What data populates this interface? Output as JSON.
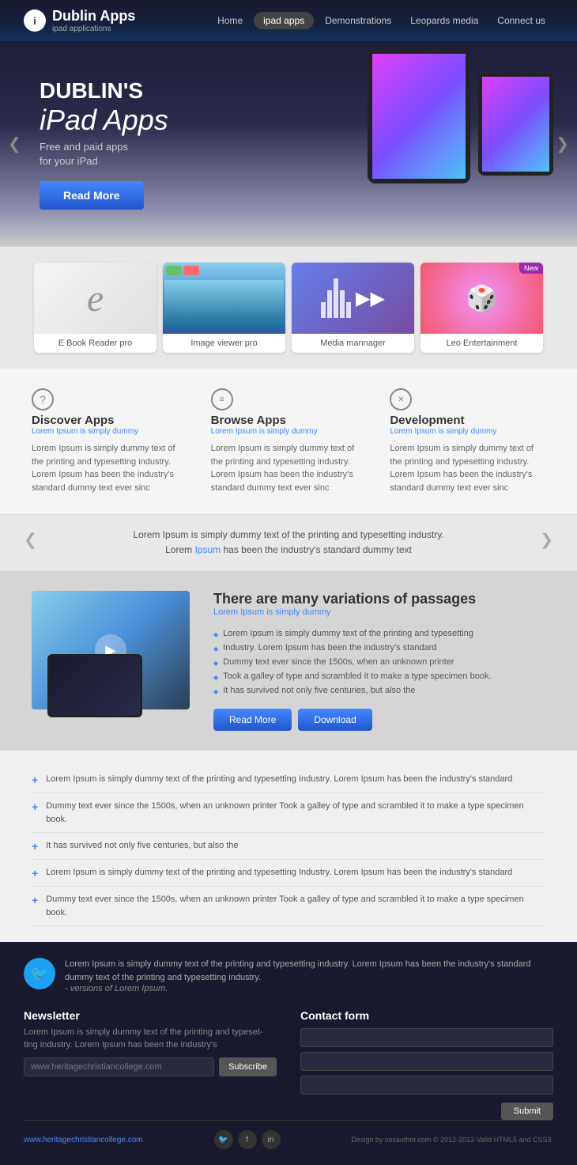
{
  "header": {
    "logo_icon": "i",
    "logo_title": "Dublin Apps",
    "logo_sub": "ipad applications",
    "nav": [
      {
        "label": "Home",
        "active": false
      },
      {
        "label": "ipad apps",
        "active": true
      },
      {
        "label": "Demonstrations",
        "active": false
      },
      {
        "label": "Leopards media",
        "active": false
      },
      {
        "label": "Connect us",
        "active": false
      }
    ]
  },
  "hero": {
    "title_main": "DUBLIN'S",
    "title_sub": "iPad Apps",
    "desc_line1": "Free and paid apps",
    "desc_line2": "for your iPad",
    "btn_read_more": "Read More",
    "arrow_left": "❮",
    "arrow_right": "❯"
  },
  "apps": {
    "items": [
      {
        "label": "E Book Reader pro",
        "type": "ebook",
        "new": false
      },
      {
        "label": "Image viewer pro",
        "type": "viewer",
        "new": false
      },
      {
        "label": "Media mannager",
        "type": "media",
        "new": false
      },
      {
        "label": "Leo Entertainment",
        "type": "leo",
        "new": true
      }
    ],
    "new_badge": "New"
  },
  "features": [
    {
      "icon": "?",
      "title": "Discover Apps",
      "sub": "Lorem Ipsum is simply dummy",
      "text": "Lorem Ipsum is simply dummy text of the printing and typesetting industry. Lorem Ipsum has been the industry's standard dummy text ever sinc"
    },
    {
      "icon": "☰",
      "title": "Browse Apps",
      "sub": "Lorem Ipsum is simply dummy",
      "text": "Lorem Ipsum is simply dummy text of the printing and typesetting industry. Lorem Ipsum has been the industry's standard dummy text ever sinc"
    },
    {
      "icon": "✕",
      "title": "Development",
      "sub": "Lorem Ipsum is simply dummy",
      "text": "Lorem Ipsum is simply dummy text of the printing and typesetting industry. Lorem Ipsum has been the industry's standard dummy text ever sinc"
    }
  ],
  "testimonial": {
    "text1": "Lorem Ipsum is simply dummy text of the printing and typesetting industry.",
    "text2": "Lorem ",
    "text2_highlight": "Ipsum",
    "text2_rest": " has been the industry's standard dummy text"
  },
  "video_section": {
    "title": "There are many variations of passages",
    "sub": "Lorem Ipsum is simply dummy",
    "list": [
      "Lorem Ipsum is simply dummy text of the printing and typesetting",
      "Industry. Lorem Ipsum has been the industry's standard",
      "Dummy text ever since the 1500s, when an unknown printer",
      "Took a galley of type and scrambled it to make a type specimen book.",
      "It has survived not only five centuries, but also the"
    ],
    "btn_read": "Read More",
    "btn_download": "Download"
  },
  "accordion": {
    "items": [
      {
        "text": "Lorem Ipsum is simply dummy text of the printing and typesetting Industry. Lorem Ipsum has been the industry's standard"
      },
      {
        "text": "Dummy text ever since the 1500s, when an unknown printer Took a galley of type and scrambled it to make a type specimen book."
      },
      {
        "text": "It has survived not only five centuries, but also the"
      },
      {
        "text": "Lorem Ipsum is simply dummy text of the printing and typesetting Industry. Lorem Ipsum has been the industry's standard"
      },
      {
        "text": "Dummy text ever since the 1500s, when an unknown printer Took a galley of type and scrambled it to make a type specimen book."
      }
    ]
  },
  "footer": {
    "tweet_text": "Lorem Ipsum is simply dummy text of the printing and typesetting industry. Lorem Ipsum has been the industry's standard dummy text  of the printing and typesetting industry.",
    "tweet_italic": "- versions of Lorem Ipsum.",
    "newsletter_title": "Newsletter",
    "newsletter_text": "Lorem Ipsum is simply dummy text of the printing and typeset-ting industry. Lorem Ipsum has been the industry's",
    "newsletter_input_placeholder": "www.heritagechristiancollege.com",
    "subscribe_btn": "Subscribe",
    "contact_title": "Contact form",
    "submit_btn": "Submit",
    "copyright": "Design by cosauthor.com © 2012-2013  Valid HTML5 and CSS3.",
    "url": "www.heritagechristiancollege.com"
  }
}
